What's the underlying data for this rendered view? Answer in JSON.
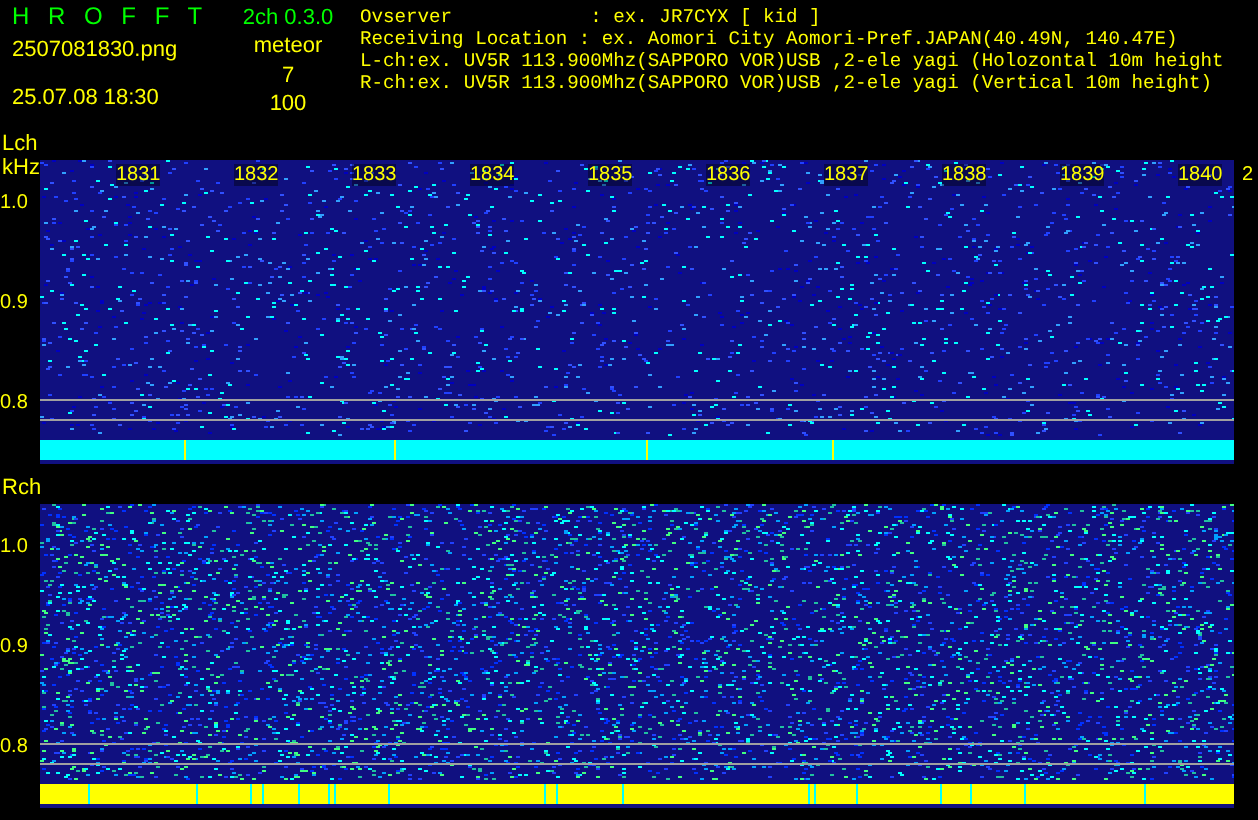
{
  "header": {
    "title": "H R O F F T",
    "version": "2ch 0.3.0",
    "file": "2507081830.png",
    "meteor_label": "meteor",
    "meteor_count": "7",
    "timestamp": "25.07.08 18:30",
    "meteor_value": "100"
  },
  "info": [
    "Ovserver            : ex. JR7CYX [ kid ]",
    "Receiving Location : ex. Aomori City Aomori-Pref.JAPAN(40.49N, 140.47E)",
    "L-ch:ex. UV5R 113.900Mhz(SAPPORO VOR)USB ,2-ele yagi (Holozontal 10m height",
    "R-ch:ex. UV5R 113.900Mhz(SAPPORO VOR)USB ,2-ele yagi (Vertical 10m height)"
  ],
  "time_labels": [
    "1831",
    "1832",
    "1833",
    "1834",
    "1835",
    "1836",
    "1837",
    "1838",
    "1839",
    "1840",
    "2"
  ],
  "channels": [
    {
      "label": "Lch",
      "unit": "kHz",
      "yticks": [
        "1.0",
        "0.9",
        "0.8"
      ],
      "color": "#00ffff"
    },
    {
      "label": "Rch",
      "yticks": [
        "1.0",
        "0.9",
        "0.8"
      ],
      "color": "#ffff00"
    }
  ]
}
